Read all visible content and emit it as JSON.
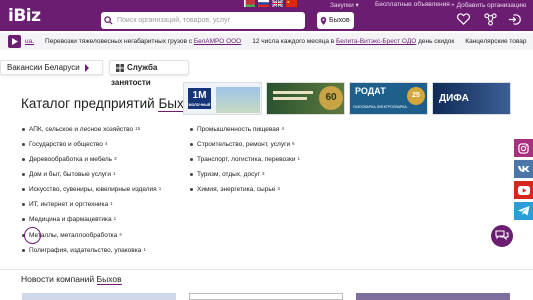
{
  "header": {
    "logo": "iBiz",
    "search_placeholder": "Поиск организаций, товаров, услуг",
    "city": "Быхов",
    "links": {
      "purchases": "Закупки",
      "free_ads": "Бесплатные объявления",
      "add_company": "+ Добавить организацию"
    },
    "icons": [
      "heart-icon",
      "network-icon",
      "login-icon"
    ]
  },
  "ticker": {
    "items": [
      {
        "text": "ua.",
        "link": ""
      },
      {
        "text": "Перевозки тяжеловесных негабаритных грузов с ",
        "link": "БелАМРО ООО"
      },
      {
        "text": "12 числа каждого месяца в ",
        "link": "Белита-Витэкс-Брест ОДО",
        "tail": " день скидок"
      },
      {
        "text": "Канцелярские товар",
        "link": ""
      }
    ]
  },
  "tabs": {
    "vacancies": "Вакансии Беларуси",
    "service_line1": "Служба",
    "service_line2": "занятости"
  },
  "main": {
    "title_prefix": "Каталог предприятий",
    "title_city": "Быхов"
  },
  "categories_left": [
    {
      "label": "АПК, сельское и лесное хозяйство",
      "count": "15"
    },
    {
      "label": "Государство и общество",
      "count": "4"
    },
    {
      "label": "Деревообработка и мебель",
      "count": "3"
    },
    {
      "label": "Дом и быт, бытовые услуги",
      "count": "1"
    },
    {
      "label": "Искусство, сувениры, ювелирные изделия",
      "count": "1"
    },
    {
      "label": "ИТ, интернет и оргтехника",
      "count": "1"
    },
    {
      "label": "Медицина и фармацевтика",
      "count": "1"
    },
    {
      "label": "Металлы, металлообработка",
      "count": "4"
    },
    {
      "label": "Полиграфия, издательство, упаковка",
      "count": "1"
    }
  ],
  "categories_right": [
    {
      "label": "Промышленность пищевая",
      "count": "4"
    },
    {
      "label": "Строительство, ремонт, услуги",
      "count": "6"
    },
    {
      "label": "Транспорт, логистика, перевозки",
      "count": "1"
    },
    {
      "label": "Туризм, отдых, досуг",
      "count": "3"
    },
    {
      "label": "Химия, энергетика, сырье",
      "count": "3"
    }
  ],
  "banners": [
    {
      "text": "1М",
      "sub": "МОЛОЧНЫЙ"
    },
    {
      "text": "60",
      "sub": ""
    },
    {
      "text": "РОДАТ",
      "sub": "ГАЗОСВАРКА-ЭЛЕКТРОСВАРКА"
    },
    {
      "text": "ДИФА",
      "sub": ""
    }
  ],
  "news": {
    "title_prefix": "Новости компаний",
    "title_city": "Быхов"
  },
  "social": [
    "instagram-icon",
    "vk-icon",
    "youtube-icon",
    "telegram-icon"
  ],
  "colors": {
    "brand": "#6b1d72",
    "instagram": "#a7307f",
    "vk": "#4a76a8",
    "youtube": "#d9261c",
    "telegram": "#2c9ed7"
  }
}
